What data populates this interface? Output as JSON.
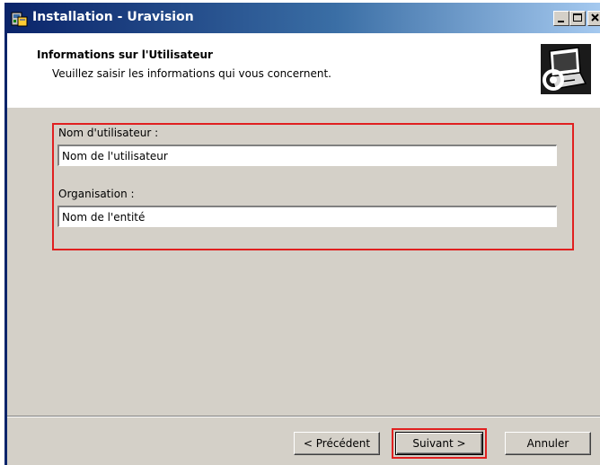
{
  "window": {
    "title": "Installation - Uravision",
    "app_icon": "installer-icon",
    "controls": [
      "minimize-icon",
      "maximize-icon",
      "close-icon"
    ]
  },
  "header": {
    "title": "Informations sur l'Utilisateur",
    "subtitle": "Veuillez saisir les informations qui vous concernent.",
    "logo_icon": "setup-computer-icon"
  },
  "form": {
    "username_label": "Nom d'utilisateur :",
    "username_value": "Nom de l'utilisateur",
    "organisation_label": "Organisation :",
    "organisation_value": "Nom de l'entité"
  },
  "buttons": {
    "back": "< Précédent",
    "next": "Suivant >",
    "cancel": "Annuler"
  },
  "colors": {
    "highlight": "#e02020",
    "titlebar_start": "#0a246a",
    "titlebar_end": "#a6caf0",
    "dialog_bg": "#d4d0c8"
  }
}
